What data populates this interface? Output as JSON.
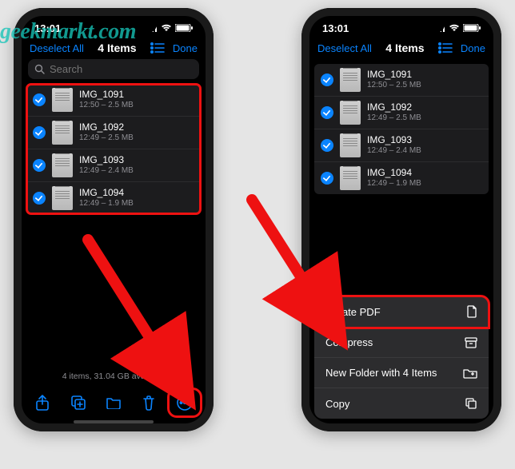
{
  "watermark": "geekmarkt.com",
  "status": {
    "time": "13:01"
  },
  "nav": {
    "deselect": "Deselect All",
    "title": "4 Items",
    "done": "Done"
  },
  "search": {
    "placeholder": "Search"
  },
  "files": [
    {
      "name": "IMG_1091",
      "sub": "12:50 – 2.5 MB"
    },
    {
      "name": "IMG_1092",
      "sub": "12:49 – 2.5 MB"
    },
    {
      "name": "IMG_1093",
      "sub": "12:49 – 2.4 MB"
    },
    {
      "name": "IMG_1094",
      "sub": "12:49 – 1.9 MB"
    }
  ],
  "footer": "4 items, 31.04 GB available",
  "actions": {
    "createPDF": "Create PDF",
    "compress": "Compress",
    "newFolder": "New Folder with 4 Items",
    "copy": "Copy"
  }
}
